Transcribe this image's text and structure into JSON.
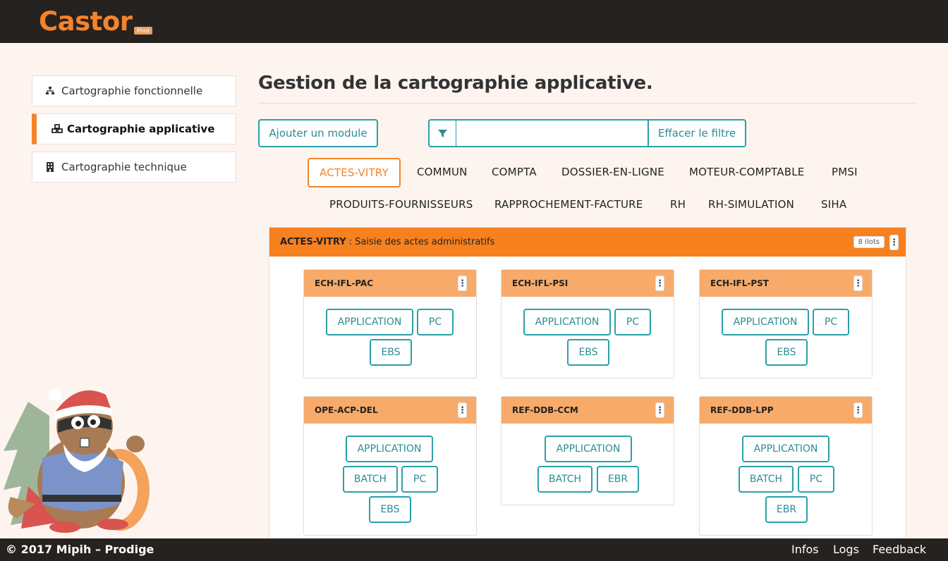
{
  "app": {
    "name": "Castor",
    "env": "Prod"
  },
  "sidebar": {
    "items": [
      {
        "label": "Cartographie fonctionnelle",
        "icon": "sitemap-icon",
        "active": false
      },
      {
        "label": "Cartographie applicative",
        "icon": "cubes-icon",
        "active": true
      },
      {
        "label": "Cartographie technique",
        "icon": "building-icon",
        "active": false
      }
    ]
  },
  "main": {
    "title": "Gestion de la cartographie applicative.",
    "add_button": "Ajouter un module",
    "filter": {
      "value": "",
      "placeholder": "",
      "clear_label": "Effacer le filtre",
      "icon": "filter-icon"
    },
    "tabs": [
      "ACTES-VITRY",
      "COMMUN",
      "COMPTA",
      "DOSSIER-EN-LIGNE",
      "MOTEUR-COMPTABLE",
      "PMSI",
      "PRODUITS-FOURNISSEURS",
      "RAPPROCHEMENT-FACTURE",
      "RH",
      "RH-SIMULATION",
      "SIHA"
    ],
    "active_tab": "ACTES-VITRY",
    "panel": {
      "name": "ACTES-VITRY",
      "description": ": Saisie des actes administratifs",
      "count": "8 ilots",
      "cards": [
        {
          "name": "ECH-IFL-PAC",
          "chips": [
            "APPLICATION",
            "PC",
            "EBS"
          ]
        },
        {
          "name": "ECH-IFL-PSI",
          "chips": [
            "APPLICATION",
            "PC",
            "EBS"
          ]
        },
        {
          "name": "ECH-IFL-PST",
          "chips": [
            "APPLICATION",
            "PC",
            "EBS"
          ]
        },
        {
          "name": "OPE-ACP-DEL",
          "chips": [
            "APPLICATION",
            "BATCH",
            "PC",
            "EBS"
          ]
        },
        {
          "name": "REF-DDB-CCM",
          "chips": [
            "APPLICATION",
            "BATCH",
            "EBR"
          ]
        },
        {
          "name": "REF-DDB-LPP",
          "chips": [
            "APPLICATION",
            "BATCH",
            "PC",
            "EBR"
          ]
        }
      ]
    }
  },
  "footer": {
    "copyright": "© 2017 Mipih – Prodige",
    "links": [
      "Infos",
      "Logs",
      "Feedback"
    ]
  },
  "colors": {
    "accent": "#f5832a",
    "teal": "#2aa0a8",
    "dark": "#262220",
    "card_head": "#f8aa6a"
  }
}
